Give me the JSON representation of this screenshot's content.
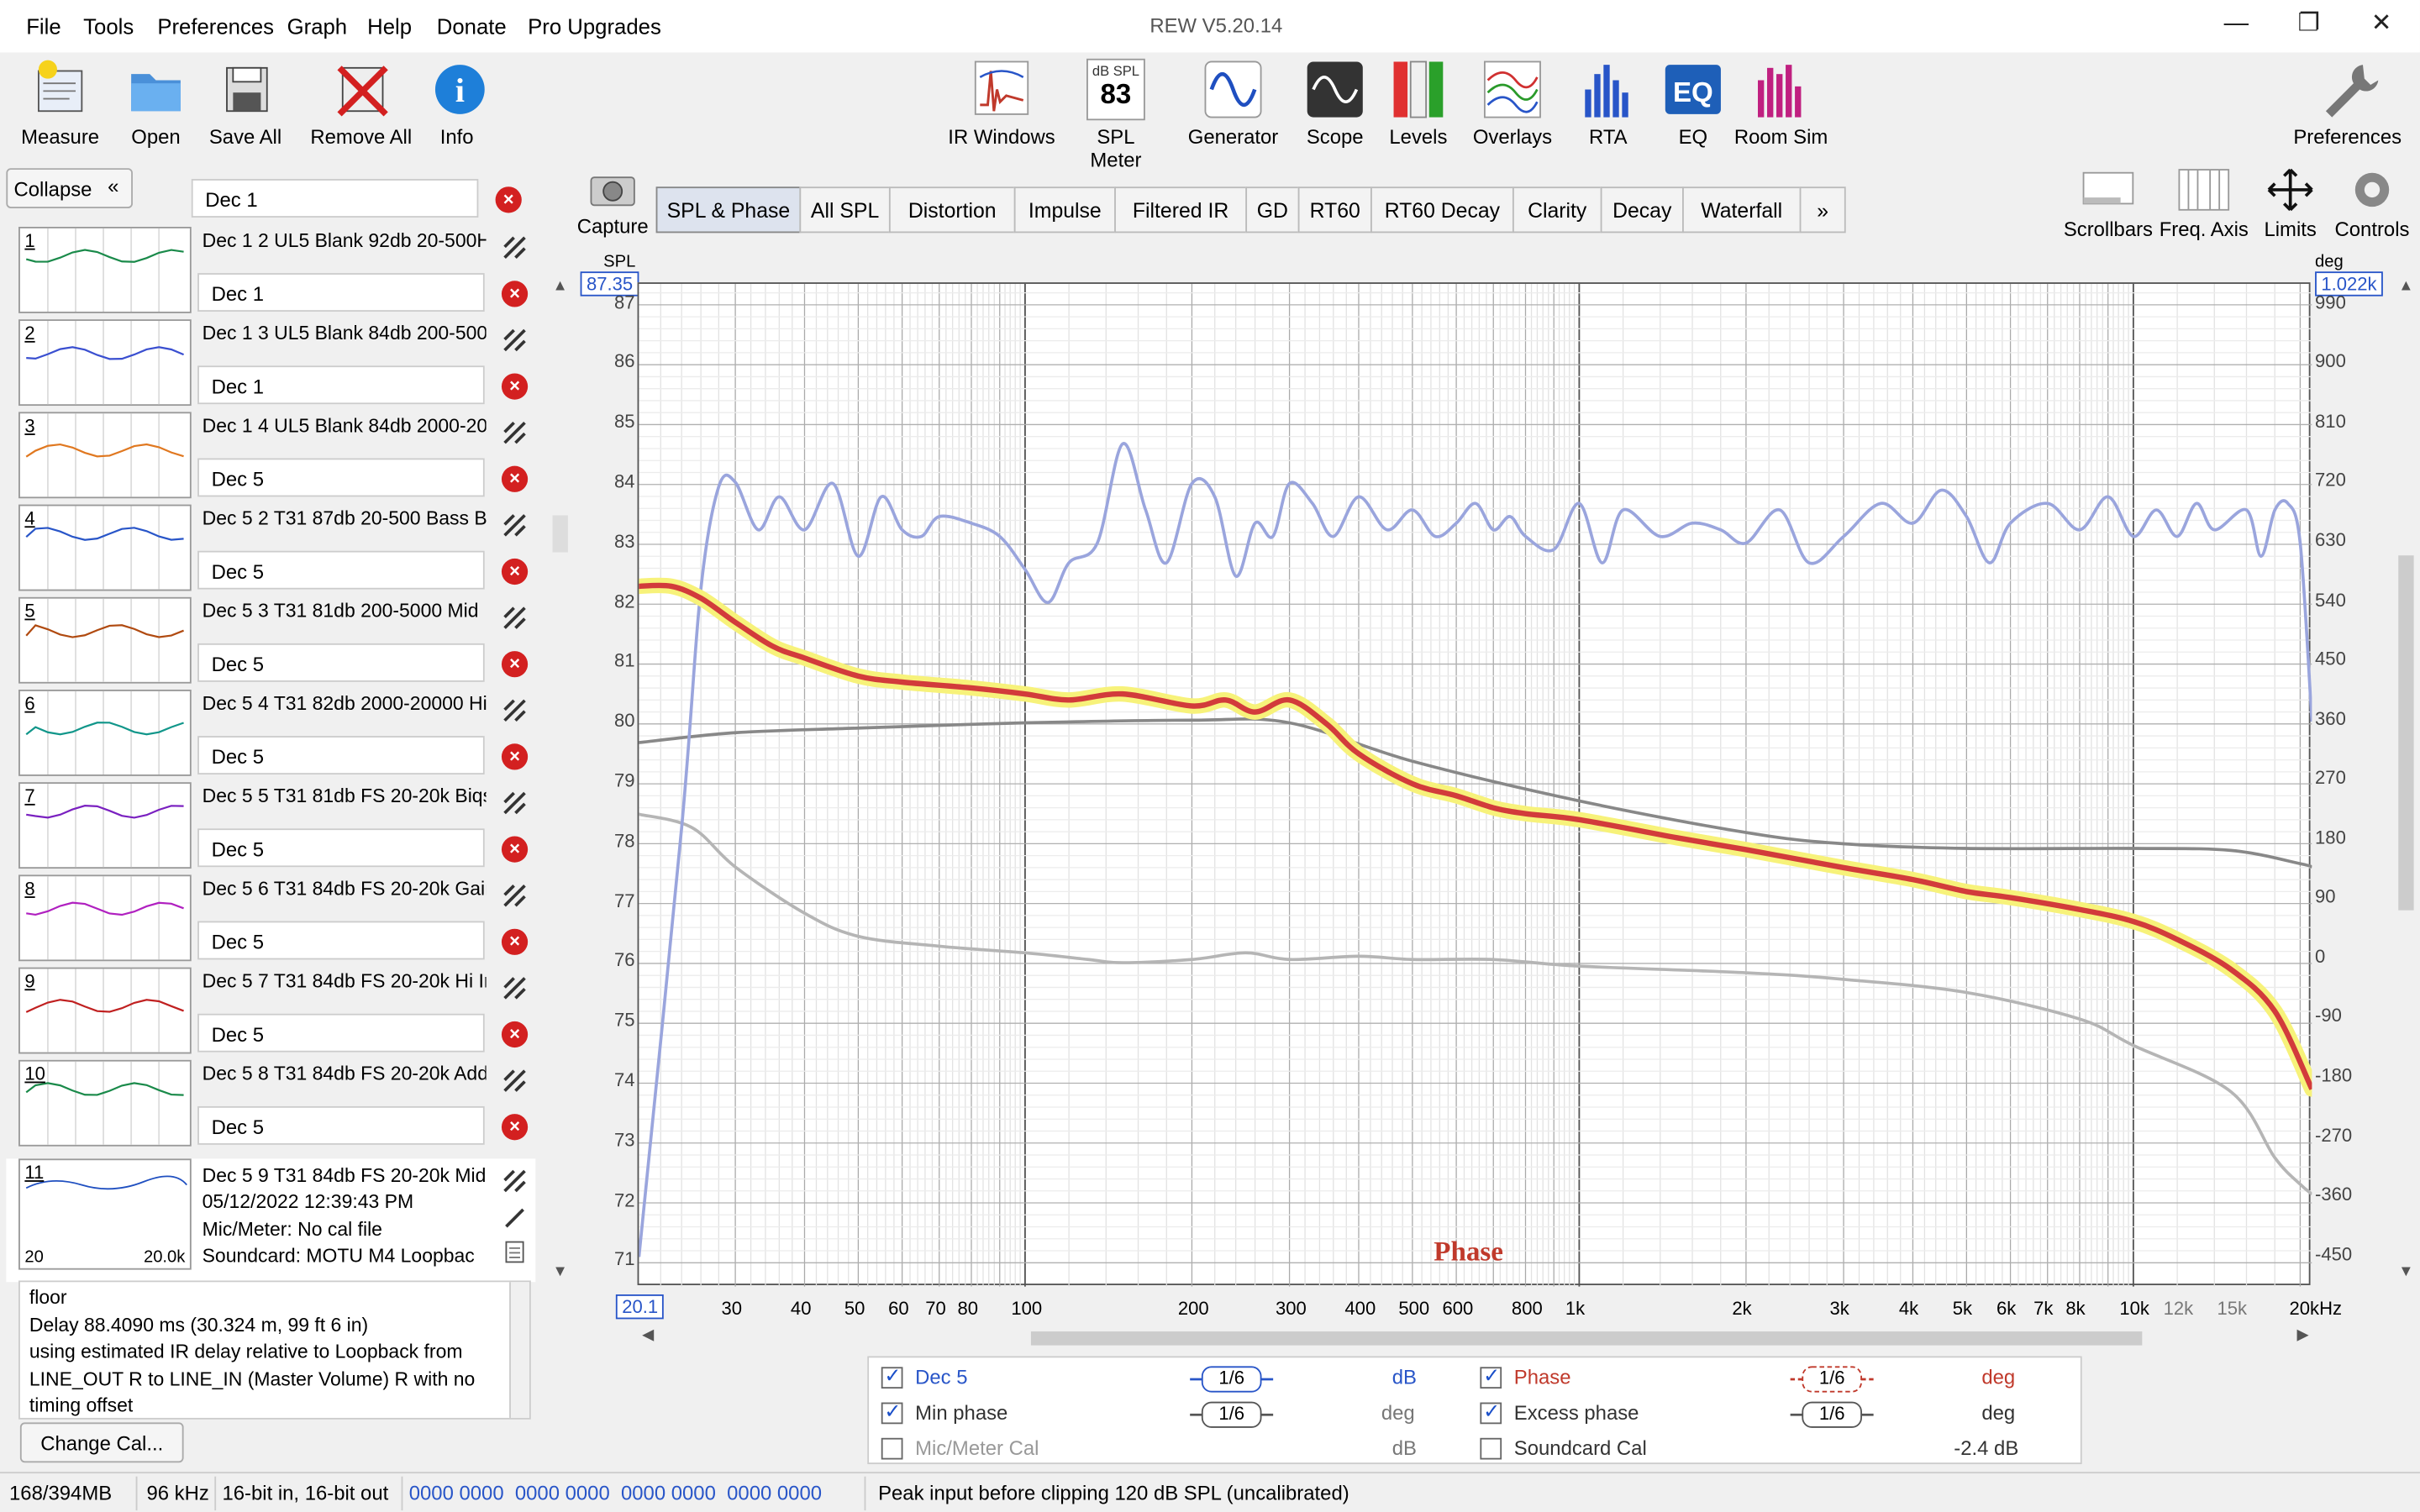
{
  "app": {
    "title": "REW V5.20.14"
  },
  "menu": [
    "File",
    "Tools",
    "Preferences",
    "Graph",
    "Help",
    "Donate",
    "Pro Upgrades"
  ],
  "window_controls": {
    "minimize": "—",
    "restore": "❐",
    "close": "✕"
  },
  "toolbar_left": [
    {
      "label": "Measure",
      "icon": "measure-icon"
    },
    {
      "label": "Open",
      "icon": "folder-icon"
    },
    {
      "label": "Save All",
      "icon": "save-all-icon"
    },
    {
      "label": "Remove All",
      "icon": "remove-all-icon"
    },
    {
      "label": "Info",
      "icon": "info-icon"
    }
  ],
  "toolbar_center": [
    {
      "label": "IR Windows",
      "icon": "ir-windows-icon"
    },
    {
      "label": "SPL Meter",
      "icon": "spl-meter-icon",
      "badge_top": "dB SPL",
      "badge_value": "83"
    },
    {
      "label": "Generator",
      "icon": "generator-icon"
    },
    {
      "label": "Scope",
      "icon": "scope-icon"
    },
    {
      "label": "Levels",
      "icon": "levels-icon"
    },
    {
      "label": "Overlays",
      "icon": "overlays-icon"
    },
    {
      "label": "RTA",
      "icon": "rta-icon"
    },
    {
      "label": "EQ",
      "icon": "eq-icon"
    },
    {
      "label": "Room Sim",
      "icon": "room-sim-icon"
    }
  ],
  "toolbar_right": {
    "label": "Preferences",
    "icon": "wrench-icon"
  },
  "left_panel": {
    "collapse_label": "Collapse",
    "top_edit": "Dec 1",
    "measurements": [
      {
        "num": "1",
        "name": "Dec 1 2 UL5 Blank 92db 20-500H",
        "next_edit": "Dec 1"
      },
      {
        "num": "2",
        "name": "Dec 1 3 UL5 Blank 84db 200-500",
        "next_edit": "Dec 1"
      },
      {
        "num": "3",
        "name": "Dec 1 4 UL5 Blank 84db 2000-20",
        "next_edit": "Dec 5"
      },
      {
        "num": "4",
        "name": "Dec 5 2 T31 87db 20-500 Bass Bi",
        "next_edit": "Dec 5"
      },
      {
        "num": "5",
        "name": "Dec 5 3 T31 81db 200-5000 Mid",
        "next_edit": "Dec 5"
      },
      {
        "num": "6",
        "name": "Dec 5 4 T31 82db 2000-20000 Hi",
        "next_edit": "Dec 5"
      },
      {
        "num": "7",
        "name": "Dec 5 5 T31 81db FS 20-20k Biqs",
        "next_edit": "Dec 5"
      },
      {
        "num": "8",
        "name": "Dec 5 6 T31 84db FS 20-20k Gair",
        "next_edit": "Dec 5"
      },
      {
        "num": "9",
        "name": "Dec 5 7 T31 84db FS 20-20k Hi Ir",
        "next_edit": "Dec 5"
      },
      {
        "num": "10",
        "name": "Dec 5 8 T31 84db FS 20-20k Add",
        "next_edit": "Dec 5"
      }
    ],
    "selected": {
      "num": "11",
      "name": "Dec 5 9 T31 84db FS 20-20k Mid",
      "date": "05/12/2022 12:39:43 PM",
      "mic": "Mic/Meter: No cal file",
      "soundcard": "Soundcard: MOTU M4 Loopbac",
      "thumb_left": "20",
      "thumb_right": "20.0k"
    },
    "notes": [
      "floor",
      "Delay 88.4090 ms (30.324 m, 99 ft 6 in)",
      "using estimated IR delay relative to Loopback from",
      "LINE_OUT R to LINE_IN (Master Volume) R with no",
      "timing offset"
    ],
    "change_cal_label": "Change Cal..."
  },
  "graph": {
    "capture_label": "Capture",
    "tabs": [
      "SPL & Phase",
      "All SPL",
      "Distortion",
      "Impulse",
      "Filtered IR",
      "GD",
      "RT60",
      "RT60 Decay",
      "Clarity",
      "Decay",
      "Waterfall",
      "»"
    ],
    "right_tools": [
      "Scrollbars",
      "Freq. Axis",
      "Limits",
      "Controls"
    ],
    "left_axis_unit": "SPL",
    "right_axis_unit": "deg",
    "top_left_value": "87.35",
    "top_right_value": "1.022k",
    "bottom_left_value": "20.1",
    "overlay_label": "Phase"
  },
  "chart_data": {
    "type": "line",
    "x_scale": "log",
    "xlim": [
      20.1,
      21000
    ],
    "ylim": [
      70.6,
      87.35
    ],
    "y2lim": [
      -495,
      1022
    ],
    "y_ticks": [
      "87",
      "86",
      "85",
      "84",
      "83",
      "82",
      "81",
      "80",
      "79",
      "78",
      "77",
      "76",
      "75",
      "74",
      "73",
      "72",
      "71"
    ],
    "y2_ticks": [
      "990",
      "900",
      "810",
      "720",
      "630",
      "540",
      "450",
      "360",
      "270",
      "180",
      "90",
      "0",
      "-90",
      "-180",
      "-270",
      "-360",
      "-450"
    ],
    "x_ticks": [
      "30",
      "40",
      "50",
      "60",
      "70",
      "80",
      "100",
      "200",
      "300",
      "400",
      "500",
      "600",
      "800",
      "1k",
      "2k",
      "3k",
      "4k",
      "5k",
      "6k",
      "7k",
      "8k",
      "10k",
      "12k",
      "15k",
      "20kHz"
    ],
    "grid": true,
    "series": [
      {
        "name": "Dec 5",
        "unit": "dB",
        "color": "#d23b3b",
        "highlight": "#f7f27a",
        "x": [
          20,
          23,
          26,
          30,
          35,
          40,
          50,
          60,
          80,
          100,
          120,
          150,
          200,
          230,
          260,
          300,
          350,
          400,
          500,
          600,
          700,
          800,
          1000,
          1500,
          2000,
          3000,
          4000,
          5000,
          6000,
          8000,
          10000,
          12000,
          15000,
          18000,
          21000
        ],
        "y": [
          82.3,
          82.3,
          82.1,
          81.7,
          81.3,
          81.1,
          80.8,
          80.7,
          80.6,
          80.5,
          80.4,
          80.5,
          80.3,
          80.4,
          80.2,
          80.4,
          80.0,
          79.5,
          79.0,
          78.8,
          78.6,
          78.5,
          78.4,
          78.1,
          77.9,
          77.6,
          77.4,
          77.2,
          77.1,
          76.9,
          76.7,
          76.4,
          75.9,
          75.2,
          73.9
        ]
      },
      {
        "name": "Min phase",
        "unit": "deg",
        "color": "#888888",
        "x": [
          20,
          30,
          50,
          100,
          200,
          300,
          500,
          1000,
          2000,
          3000,
          5000,
          10000,
          15000,
          20000,
          21000
        ],
        "y": [
          328,
          343,
          350,
          358,
          362,
          358,
          300,
          240,
          192,
          175,
          168,
          168,
          165,
          145,
          140
        ]
      },
      {
        "name": "Phase",
        "unit": "deg",
        "color": "#9aa5dd",
        "x": [
          20.1,
          24,
          26,
          28,
          30,
          33,
          36,
          40,
          45,
          50,
          55,
          60,
          65,
          70,
          80,
          90,
          100,
          110,
          120,
          135,
          150,
          165,
          180,
          200,
          220,
          240,
          260,
          280,
          300,
          330,
          360,
          400,
          450,
          500,
          550,
          600,
          650,
          700,
          750,
          800,
          900,
          1000,
          1100,
          1200,
          1400,
          1600,
          1800,
          2000,
          2300,
          2600,
          3000,
          3500,
          4000,
          4500,
          5000,
          5500,
          6000,
          7000,
          8000,
          9000,
          10000,
          11000,
          12000,
          13000,
          14000,
          16000,
          17000,
          18000,
          19000,
          20000,
          21000
        ],
        "y": [
          -450,
          200,
          560,
          715,
          722,
          650,
          700,
          650,
          720,
          610,
          700,
          650,
          640,
          670,
          660,
          640,
          590,
          540,
          600,
          630,
          780,
          680,
          600,
          720,
          700,
          580,
          660,
          640,
          720,
          690,
          640,
          700,
          650,
          680,
          640,
          660,
          690,
          650,
          670,
          640,
          620,
          690,
          600,
          680,
          640,
          660,
          650,
          630,
          680,
          600,
          640,
          690,
          660,
          710,
          670,
          600,
          660,
          690,
          650,
          700,
          640,
          680,
          640,
          690,
          650,
          680,
          610,
          680,
          690,
          630,
          360
        ]
      },
      {
        "name": "Excess phase",
        "unit": "deg",
        "color": "#b5b5b5",
        "x": [
          20,
          25,
          30,
          40,
          50,
          70,
          100,
          130,
          150,
          200,
          250,
          300,
          400,
          500,
          700,
          1000,
          2000,
          3000,
          5000,
          8000,
          10000,
          15000,
          18000,
          20000,
          21000
        ],
        "y": [
          220,
          200,
          140,
          70,
          35,
          20,
          10,
          0,
          -5,
          0,
          10,
          0,
          5,
          0,
          0,
          -10,
          -20,
          -30,
          -50,
          -90,
          -130,
          -200,
          -300,
          -340,
          -355
        ]
      }
    ]
  },
  "legend": {
    "rows": [
      {
        "left_label": "Dec 5",
        "left_checked": true,
        "left_smooth": "1/6",
        "left_unit": "dB",
        "right_label": "Phase",
        "right_checked": true,
        "right_smooth": "1/6",
        "right_unit": "deg"
      },
      {
        "left_label": "Min phase",
        "left_checked": true,
        "left_smooth": "1/6",
        "left_unit": "deg",
        "right_label": "Excess phase",
        "right_checked": true,
        "right_smooth": "1/6",
        "right_unit": "deg"
      },
      {
        "left_label": "Mic/Meter Cal",
        "left_checked": false,
        "left_smooth": "",
        "left_unit": "dB",
        "right_label": "Soundcard Cal",
        "right_checked": false,
        "right_smooth": "",
        "right_unit": "-2.4 dB"
      }
    ]
  },
  "status": {
    "memory": "168/394MB",
    "rate": "96 kHz",
    "bits": "16-bit in, 16-bit out",
    "levels": "0000 0000  0000 0000  0000 0000  0000 0000",
    "clip": "Peak input before clipping 120 dB SPL (uncalibrated)"
  }
}
